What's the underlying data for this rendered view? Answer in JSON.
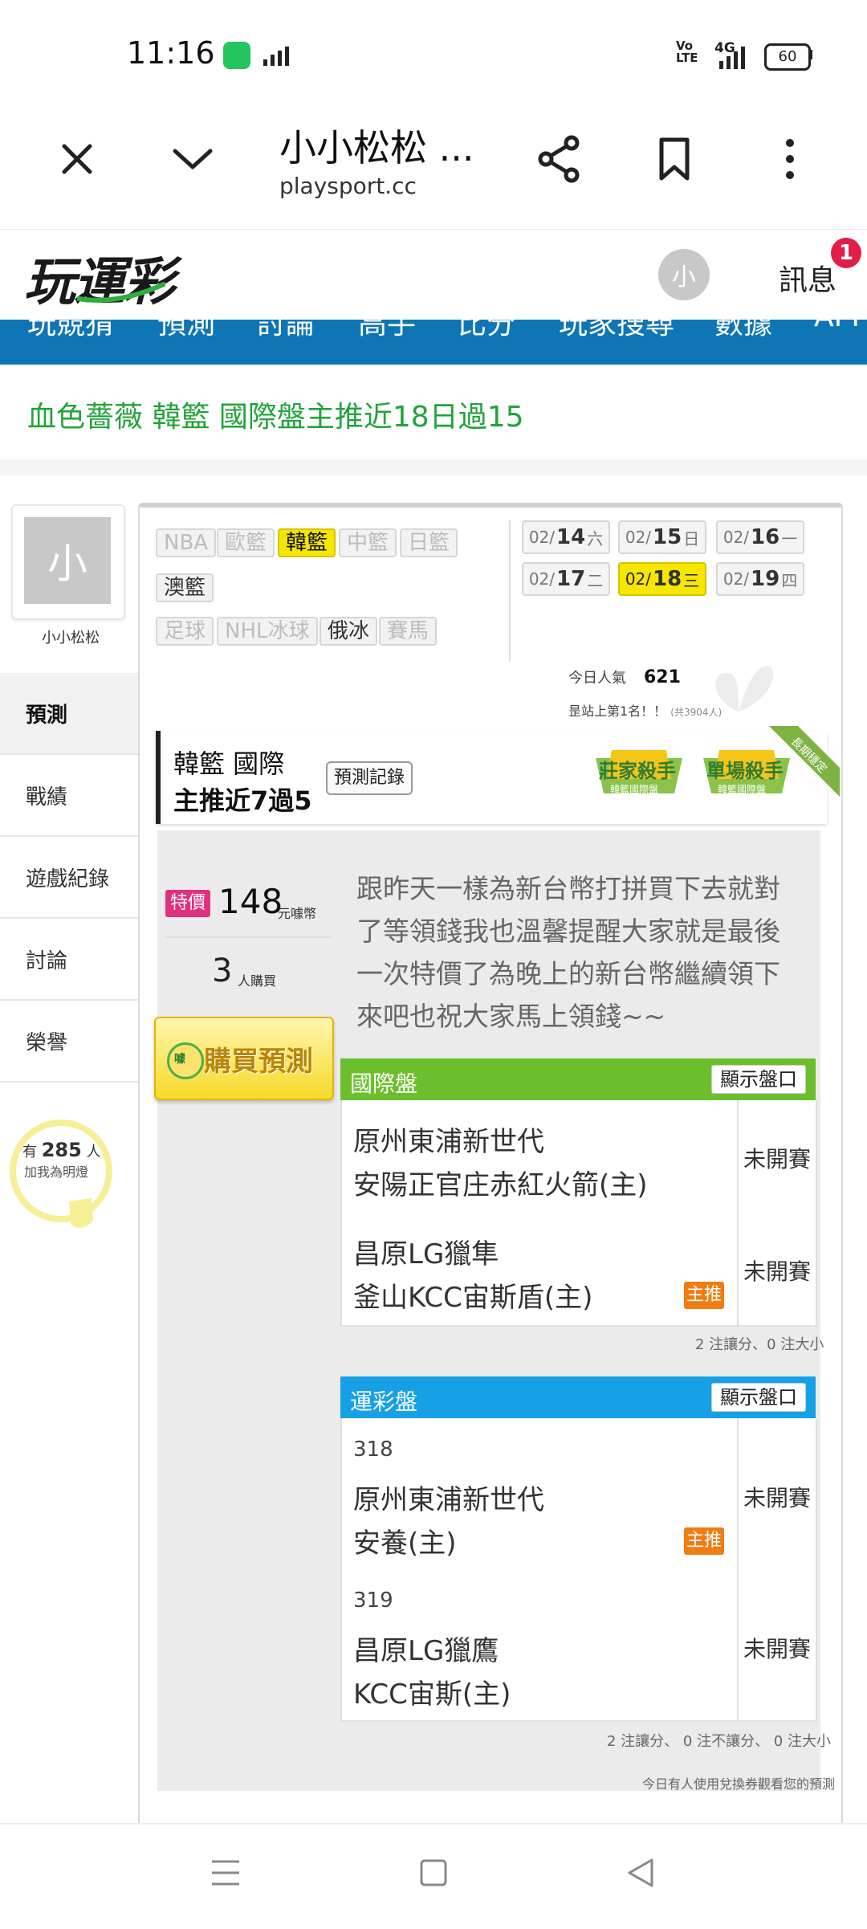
{
  "status_bar": {
    "time": "11:16",
    "net_badge": "Vo LTE",
    "net_type": "4G",
    "battery": "60"
  },
  "browser": {
    "title": "小小松松 ...",
    "url": "playsport.cc"
  },
  "site": {
    "logo": "玩運彩",
    "avatar_char": "小",
    "messages_label": "訊息",
    "messages_count": "1",
    "nav": [
      "玩競猜",
      "預測",
      "討論",
      "高手",
      "比分",
      "玩家搜尋",
      "數據",
      "API"
    ]
  },
  "headline": "血色薔薇 韓籃 國際盤主推近18日過15",
  "profile": {
    "avatar_char": "小",
    "name": "小小松松",
    "tabs": [
      "預測",
      "戰績",
      "遊戲紀錄",
      "討論",
      "榮譽"
    ],
    "followers_prefix": "有",
    "followers_count": "285",
    "followers_suffix": "人",
    "followers_note": "加我為明燈"
  },
  "leagues": [
    "NBA",
    "歐籃",
    "韓籃",
    "中籃",
    "日籃",
    "澳籃",
    "足球",
    "NHL冰球",
    "俄冰",
    "賽馬"
  ],
  "selected_league": "韓籃",
  "dates": [
    {
      "md": "02/",
      "d": "14",
      "w": "六"
    },
    {
      "md": "02/",
      "d": "15",
      "w": "日"
    },
    {
      "md": "02/",
      "d": "16",
      "w": "一"
    },
    {
      "md": "02/",
      "d": "17",
      "w": "二"
    },
    {
      "md": "02/",
      "d": "18",
      "w": "三"
    },
    {
      "md": "02/",
      "d": "19",
      "w": "四"
    }
  ],
  "popularity": {
    "label": "今日人氣",
    "value": "621",
    "rank_text": "昰站上第1名！！",
    "rank_note": "(共3904人)"
  },
  "record": {
    "line1": "韓籃 國際",
    "line2": "主推近7過5",
    "button": "預測記錄"
  },
  "medals": [
    {
      "title": "莊家殺手",
      "sub": "韓籃國際盤"
    },
    {
      "title": "單場殺手",
      "sub": "韓籃國際盤"
    }
  ],
  "ribbon": "長期穩定",
  "offer": {
    "tag": "特價",
    "price": "148",
    "price_unit": "元噱幣",
    "buyers": "3",
    "buyers_unit": "人購買",
    "buy_button": "購買預測",
    "coin_label": "噱"
  },
  "description": "跟昨天一樣為新台幣打拼買下去就對了等領錢我也溫馨提醒大家就是最後一次特價了為晚上的新台幣繼續領下來吧也祝大家馬上領錢~~",
  "intl": {
    "title": "國際盤",
    "show_button": "顯示盤口",
    "games": [
      {
        "away": "原州東浦新世代",
        "home": "安陽正官庄赤紅火箭(主)",
        "status": "未開賽",
        "pick": ""
      },
      {
        "away": "昌原LG獵隼",
        "home": "釜山KCC宙斯盾(主)",
        "status": "未開賽",
        "pick": "主推"
      }
    ],
    "summary": "2 注讓分、0 注大小"
  },
  "lottery": {
    "title": "運彩盤",
    "show_button": "顯示盤口",
    "games": [
      {
        "num": "318",
        "away": "原州東浦新世代",
        "home": "安養(主)",
        "status": "未開賽",
        "pick": "主推"
      },
      {
        "num": "319",
        "away": "昌原LG獵鷹",
        "home": "KCC宙斯(主)",
        "status": "未開賽",
        "pick": ""
      }
    ],
    "summary": "2 注讓分、 0 注不讓分、 0 注大小"
  },
  "footnote": "今日有人使用兌換券觀看您的預測",
  "colors": {
    "nav_blue": "#0f76b6",
    "intl_green": "#6cbf2c",
    "lottery_blue": "#16a1e6",
    "highlight_yellow": "#f7e600",
    "pick_orange": "#f07c12",
    "headline_green": "#23a33a"
  }
}
